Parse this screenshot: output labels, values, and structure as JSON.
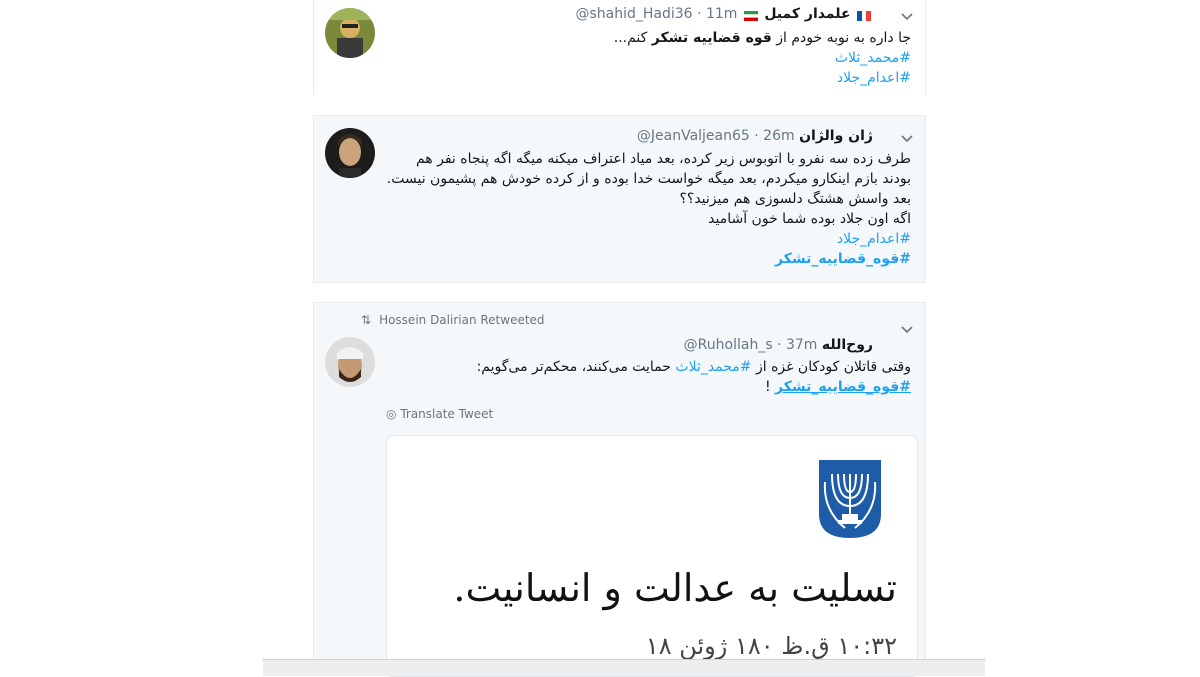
{
  "tweet1": {
    "name": "علمدار کمیل",
    "handle": "@shahid_Hadi36",
    "time": "· 11m",
    "text_pre": "جا داره به نوبه خودم از ",
    "text_bold": "قوه قضاییه تشکر",
    "text_post": " کنم...",
    "tags": [
      "#محمد_ثلاث",
      "#اعدام_جلاد"
    ]
  },
  "tweet2": {
    "name": "ژان والژان",
    "handle": "@JeanValjean65",
    "time": "· 26m",
    "lines": [
      "طرف زده سه نفرو با اتوبوس زیر کرده، بعد میاد اعتراف میکنه میگه اگه پنجاه نفر هم",
      "بودند بازم اینکارو میکردم، بعد میگه خواست خدا بوده و از کرده خودش هم پشیمون نیست.",
      "بعد واسش هشتگ دلسوزی هم میزنید؟؟",
      "اگه اون جلاد بوده شما خون آشامید"
    ],
    "tags": [
      "#اعدام_جلاد",
      "#قوه_قضاییه_تشکر"
    ]
  },
  "tweet3": {
    "retweeted_by": "Hossein Dalirian Retweeted",
    "name": "روح‌الله",
    "handle": "@Ruhollah_s",
    "time": "· 37m",
    "line1_pre": "وقتی قاتلان کودکان غزه از ",
    "line1_tag": "#محمد_ثلاث",
    "line1_post": " حمایت می‌کنند، محکم‌تر می‌گویم:",
    "line2_tag": "#قوه_قضاییه_تشکر",
    "line2_post": " !",
    "translate": "Translate Tweet",
    "card_text": "تسلیت به عدالت و انسانیت.",
    "card_date": "۱۰:۳۲ ق.ظ ۱۸۰ ژوئن ۱۸"
  },
  "colors": {
    "link": "#1da1f2",
    "emblem": "#1e5ca8"
  }
}
